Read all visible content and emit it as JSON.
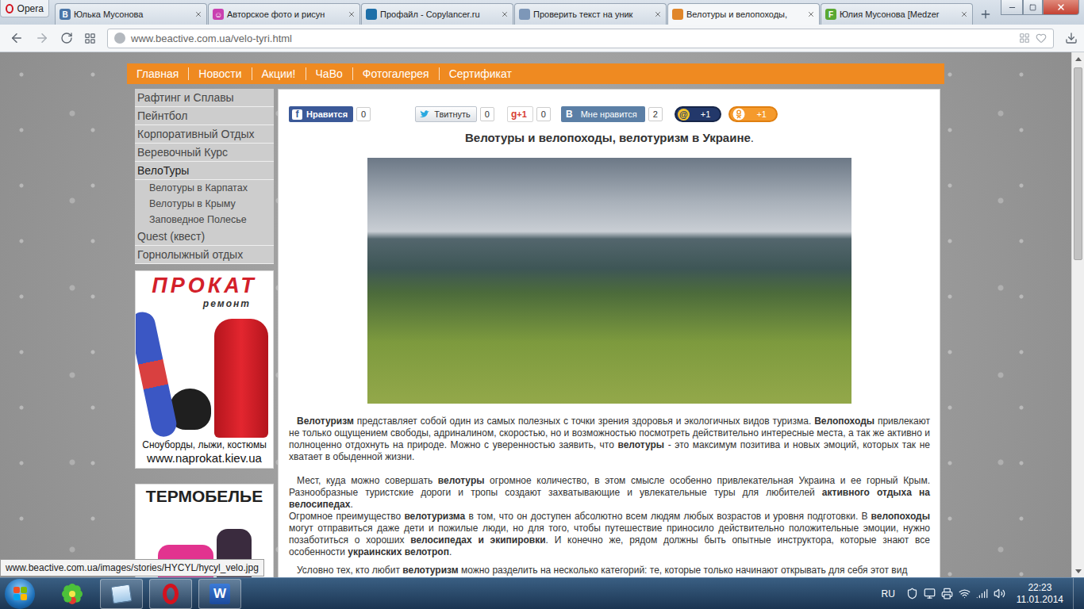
{
  "browser": {
    "menu_label": "Opera",
    "tabs": [
      {
        "label": "Юлька Мусонова",
        "selected": false,
        "icon": "В",
        "color": "#4a76a8"
      },
      {
        "label": "Авторское фото и рисун",
        "selected": false,
        "icon": "☺",
        "color": "#c93fb0"
      },
      {
        "label": "Профайл - Copylancer.ru",
        "selected": false,
        "color": "#1e6fa8"
      },
      {
        "label": "Проверить текст на уник",
        "selected": false,
        "color": "#7d97b8"
      },
      {
        "label": "Велотуры и велопоходы,",
        "selected": true,
        "color": "#e0862a"
      },
      {
        "label": "Юлия Мусонова [Medzer",
        "selected": false,
        "icon": "F",
        "color": "#5aa832"
      }
    ],
    "address": "www.beactive.com.ua/velo-tyri.html"
  },
  "site": {
    "nav": [
      "Главная",
      "Новости",
      "Акции!",
      "ЧаВо",
      "Фотогалерея",
      "Сертификат"
    ],
    "sidebar": [
      {
        "label": "Рафтинг и Сплавы",
        "kind": "item",
        "expanded": false
      },
      {
        "label": "Пейнтбол",
        "kind": "item",
        "expanded": false
      },
      {
        "label": "Корпоративный Отдых",
        "kind": "item",
        "expanded": false
      },
      {
        "label": "Веревочный Курс",
        "kind": "item",
        "expanded": false
      },
      {
        "label": "ВелоТуры",
        "kind": "item",
        "expanded": true
      },
      {
        "label": "Велотуры в Карпатах",
        "kind": "sub",
        "expanded": false
      },
      {
        "label": "Велотуры в Крыму",
        "kind": "sub",
        "expanded": false
      },
      {
        "label": "Заповедное Полесье",
        "kind": "sub",
        "expanded": false
      },
      {
        "label": "Quest (квест)",
        "kind": "item",
        "expanded": false
      },
      {
        "label": "Горнолыжный отдых",
        "kind": "item",
        "expanded": false
      }
    ],
    "prokat_banner": {
      "title": "ПРОКАТ",
      "subtitle": "ремонт",
      "caption": "Сноуборды, лыжи, костюмы",
      "url": "www.naprokat.kiev.ua"
    },
    "thermal_banner": {
      "title": "ТЕРМОБЕЛЬЕ"
    },
    "social": [
      {
        "kind": "fb",
        "icon": "f",
        "label": "Нравится",
        "count": "0"
      },
      {
        "kind": "tw",
        "label": "Твитнуть",
        "count": "0"
      },
      {
        "kind": "gp",
        "icon": "g",
        "label": "+1",
        "count": "0"
      },
      {
        "kind": "vk",
        "icon": "В",
        "label": "Мне нравится",
        "count": "2"
      },
      {
        "kind": "mail",
        "icon": "@",
        "label": "+1"
      },
      {
        "kind": "ok",
        "label": "+1"
      }
    ],
    "heading": [
      {
        "text": "Велотуры и велопоходы, велотуризм в Украине",
        "bold": true
      },
      {
        "text": ".",
        "bold": false
      }
    ],
    "paragraphs": [
      {
        "indent": true,
        "segments": [
          {
            "text": "Велотуризм",
            "bold": true
          },
          {
            "text": " представляет собой один из самых полезных с точки зрения здоровья и экологичных видов туризма. ",
            "bold": false
          },
          {
            "text": "Велопоходы",
            "bold": true
          },
          {
            "text": " привлекают не только ощущением свободы, адриналином, скоростью, но и возможностью посмотреть действительно интересные места, а так же активно и полноценно отдохнуть на природе. Можно с уверенностью заявить, что ",
            "bold": false
          },
          {
            "text": "велотуры",
            "bold": true
          },
          {
            "text": " - это максимум позитива и новых эмоций, которых так не хватает в обыденной жизни.",
            "bold": false
          }
        ]
      },
      {
        "indent": true,
        "segments": [
          {
            "text": "Мест, куда можно совершать ",
            "bold": false
          },
          {
            "text": "велотуры",
            "bold": true
          },
          {
            "text": " огромное количество, в этом смысле особенно привлекательная Украина и ее горный Крым. Разнообразные туристские дороги и тропы создают захватывающие и увлекательные туры для любителей ",
            "bold": false
          },
          {
            "text": "активного отдыха на велосипедах",
            "bold": true
          },
          {
            "text": ".",
            "bold": false
          }
        ]
      },
      {
        "indent": false,
        "segments": [
          {
            "text": "Огромное преимущество ",
            "bold": false
          },
          {
            "text": "велотуризма",
            "bold": true
          },
          {
            "text": " в том, что он доступен абсолютно всем людям любых возрастов и уровня подготовки. В ",
            "bold": false
          },
          {
            "text": "велопоходы",
            "bold": true
          },
          {
            "text": " могут отправиться даже дети и пожилые люди, но для того, чтобы путешествие приносило действительно положительные эмоции, нужно позаботиться о хороших ",
            "bold": false
          },
          {
            "text": "велосипедах и экипировки",
            "bold": true
          },
          {
            "text": ". И конечно же, рядом должны быть опытные инструктора, которые знают все особенности ",
            "bold": false
          },
          {
            "text": "украинских велотроп",
            "bold": true
          },
          {
            "text": ".",
            "bold": false
          }
        ]
      },
      {
        "indent": true,
        "segments": [
          {
            "text": "Условно тех, кто любит ",
            "bold": false
          },
          {
            "text": "велотуризм",
            "bold": true
          },
          {
            "text": " можно разделить на несколько категорий: те, которые только начинают открывать для себя этот вид",
            "bold": false
          }
        ]
      }
    ]
  },
  "status_url": "www.beactive.com.ua/images/stories/HYCYL/hycyl_velo.jpg",
  "scrollbar": {
    "level": 0.39
  },
  "taskbar": {
    "apps": [
      {
        "kind": "icq",
        "running": false
      },
      {
        "kind": "notepad",
        "running": true
      },
      {
        "kind": "opera",
        "running": true
      },
      {
        "kind": "word",
        "running": true,
        "glyph": "W"
      }
    ],
    "language": "RU",
    "time": "22:23",
    "date": "11.01.2014"
  }
}
